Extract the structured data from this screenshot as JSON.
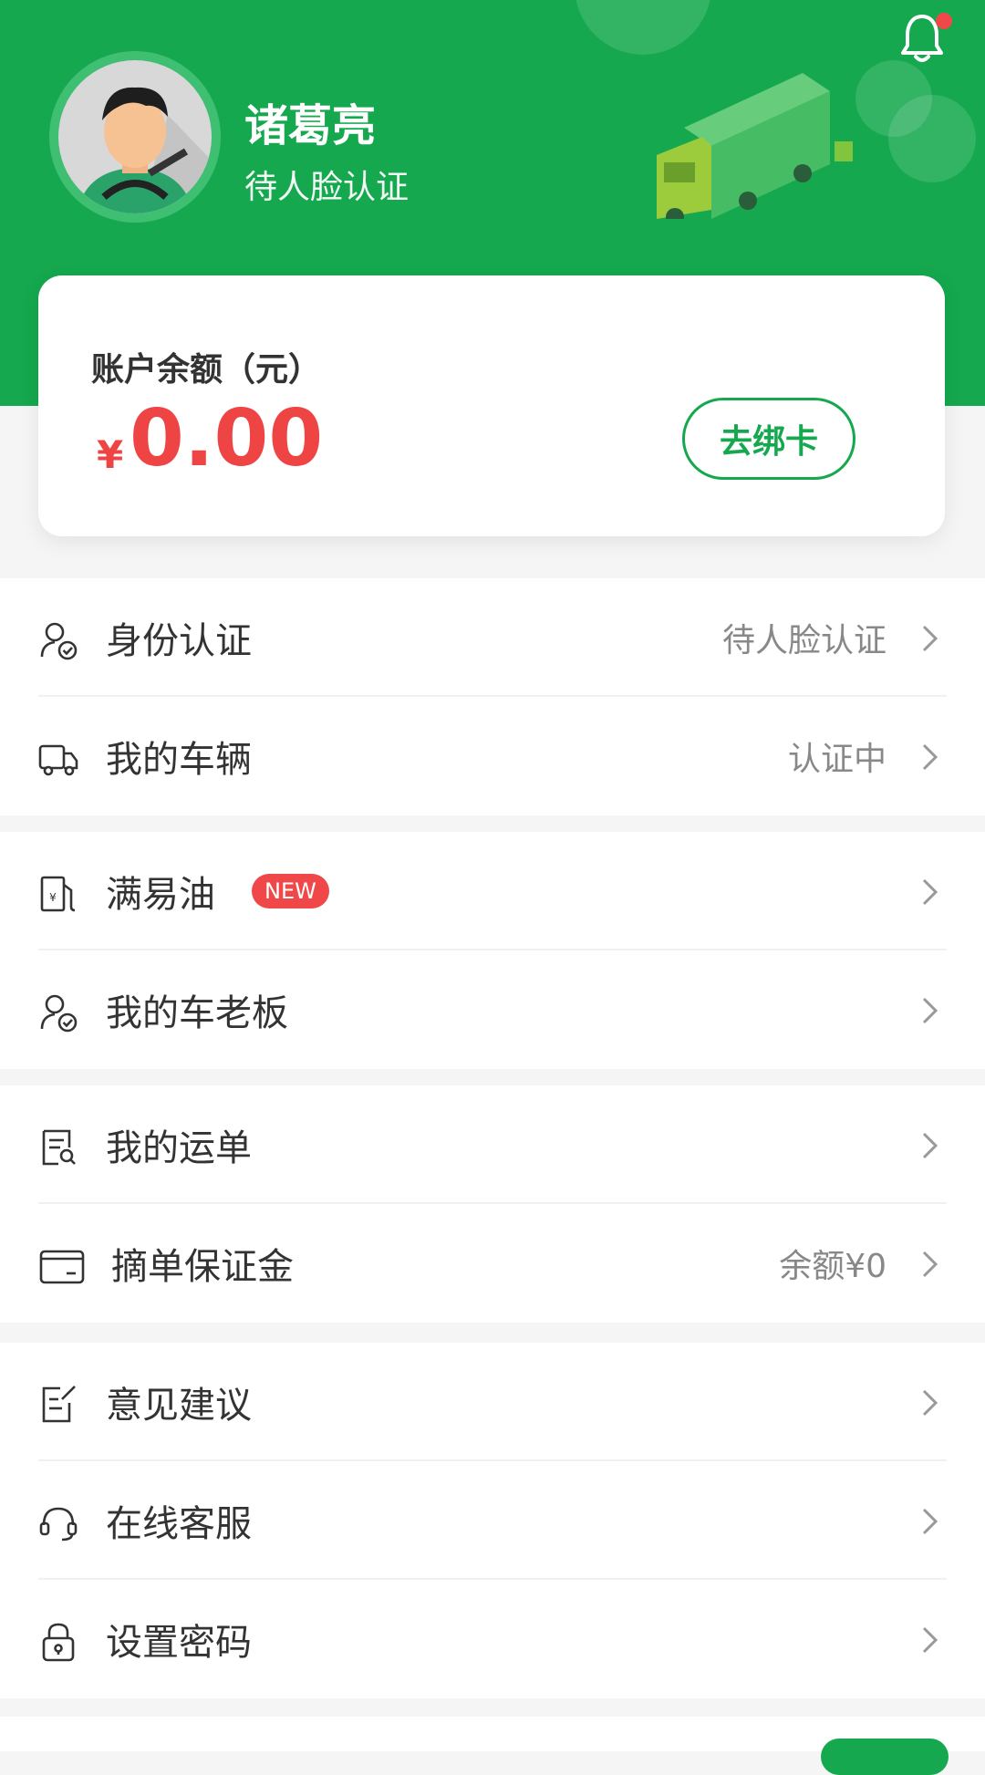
{
  "header": {
    "user_name": "诸葛亮",
    "user_status": "待人脸认证",
    "bg_color": "#15a84e"
  },
  "balance": {
    "label": "账户余额（元）",
    "currency": "¥",
    "amount": "0.00",
    "bind_button": "去绑卡",
    "amount_color": "#ee4444"
  },
  "groups": [
    {
      "items": [
        {
          "label": "身份认证",
          "icon": "id-verify-icon",
          "right_text": "待人脸认证"
        },
        {
          "label": "我的车辆",
          "icon": "truck-icon",
          "right_text": "认证中"
        }
      ]
    },
    {
      "items": [
        {
          "label": "满易油",
          "icon": "fuel-pump-icon",
          "badge": "NEW"
        },
        {
          "label": "我的车老板",
          "icon": "person-check-icon"
        }
      ]
    },
    {
      "items": [
        {
          "label": "我的运单",
          "icon": "waybill-icon"
        },
        {
          "label": "摘单保证金",
          "icon": "wallet-card-icon",
          "right_text": "余额¥0"
        }
      ]
    },
    {
      "items": [
        {
          "label": "意见建议",
          "icon": "feedback-edit-icon"
        },
        {
          "label": "在线客服",
          "icon": "headset-icon"
        },
        {
          "label": "设置密码",
          "icon": "lock-icon"
        }
      ]
    }
  ]
}
